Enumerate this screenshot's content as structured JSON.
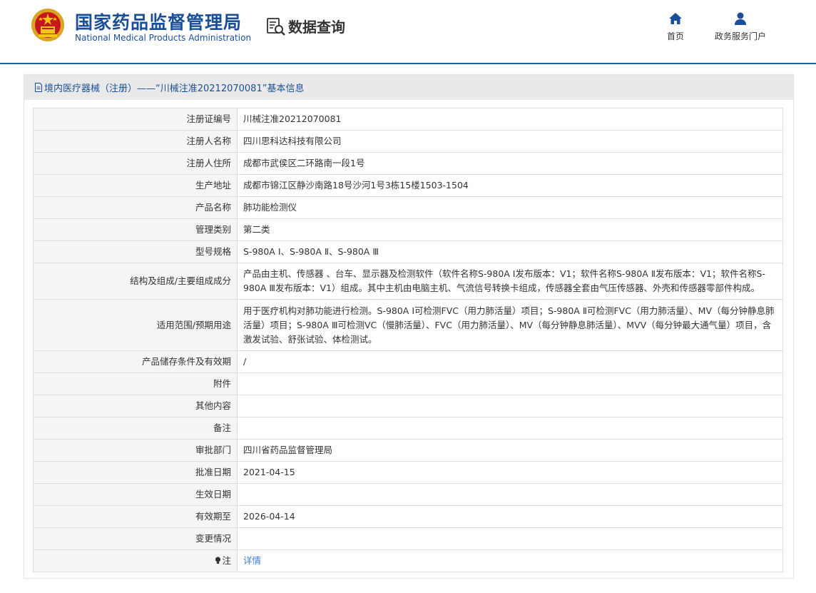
{
  "header": {
    "title_cn": "国家药品监督管理局",
    "title_en": "National Medical Products Administration",
    "query_label": "数据查询",
    "nav": {
      "home": "首页",
      "gov_portal": "政务服务门户"
    }
  },
  "panel": {
    "title": "境内医疗器械（注册）——“川械注准20212070081”基本信息"
  },
  "rows": [
    {
      "label": "注册证编号",
      "value": "川械注准20212070081"
    },
    {
      "label": "注册人名称",
      "value": "四川思科达科技有限公司"
    },
    {
      "label": "注册人住所",
      "value": "成都市武侯区二环路南一段1号"
    },
    {
      "label": "生产地址",
      "value": "成都市锦江区静沙南路18号沙河1号3栋15楼1503-1504"
    },
    {
      "label": "产品名称",
      "value": "肺功能检测仪"
    },
    {
      "label": "管理类别",
      "value": "第二类"
    },
    {
      "label": "型号规格",
      "value": "S-980A Ⅰ、S-980A Ⅱ、S-980A Ⅲ"
    },
    {
      "label": "结构及组成/主要组成成分",
      "value": "产品由主机、传感器 、台车、显示器及检测软件（软件名称S-980A Ⅰ发布版本：V1；软件名称S-980A Ⅱ发布版本：V1；软件名称S-980A Ⅲ发布版本：V1）组成。其中主机由电脑主机、气流信号转换卡组成，传感器全套由气压传感器、外壳和传感器零部件构成。"
    },
    {
      "label": "适用范围/预期用途",
      "value": "用于医疗机构对肺功能进行检测。S-980A Ⅰ可检测FVC（用力肺活量）项目；S-980A Ⅱ可检测FVC（用力肺活量）、MV（每分钟静息肺活量）项目；S-980A Ⅲ可检测VC（慢肺活量）、FVC（用力肺活量）、MV（每分钟静息肺活量）、MVV（每分钟最大通气量）项目，含激发试验、舒张试验、体检测试。"
    },
    {
      "label": "产品储存条件及有效期",
      "value": "/"
    },
    {
      "label": "附件",
      "value": ""
    },
    {
      "label": "其他内容",
      "value": ""
    },
    {
      "label": "备注",
      "value": ""
    },
    {
      "label": "审批部门",
      "value": "四川省药品监督管理局"
    },
    {
      "label": "批准日期",
      "value": "2021-04-15"
    },
    {
      "label": "生效日期",
      "value": ""
    },
    {
      "label": "有效期至",
      "value": "2026-04-14"
    },
    {
      "label": "变更情况",
      "value": ""
    },
    {
      "label": "注",
      "value": "详情"
    }
  ],
  "colors": {
    "brand": "#1a4f97",
    "link": "#3c7bd4",
    "header_line": "#1f5fa8"
  }
}
